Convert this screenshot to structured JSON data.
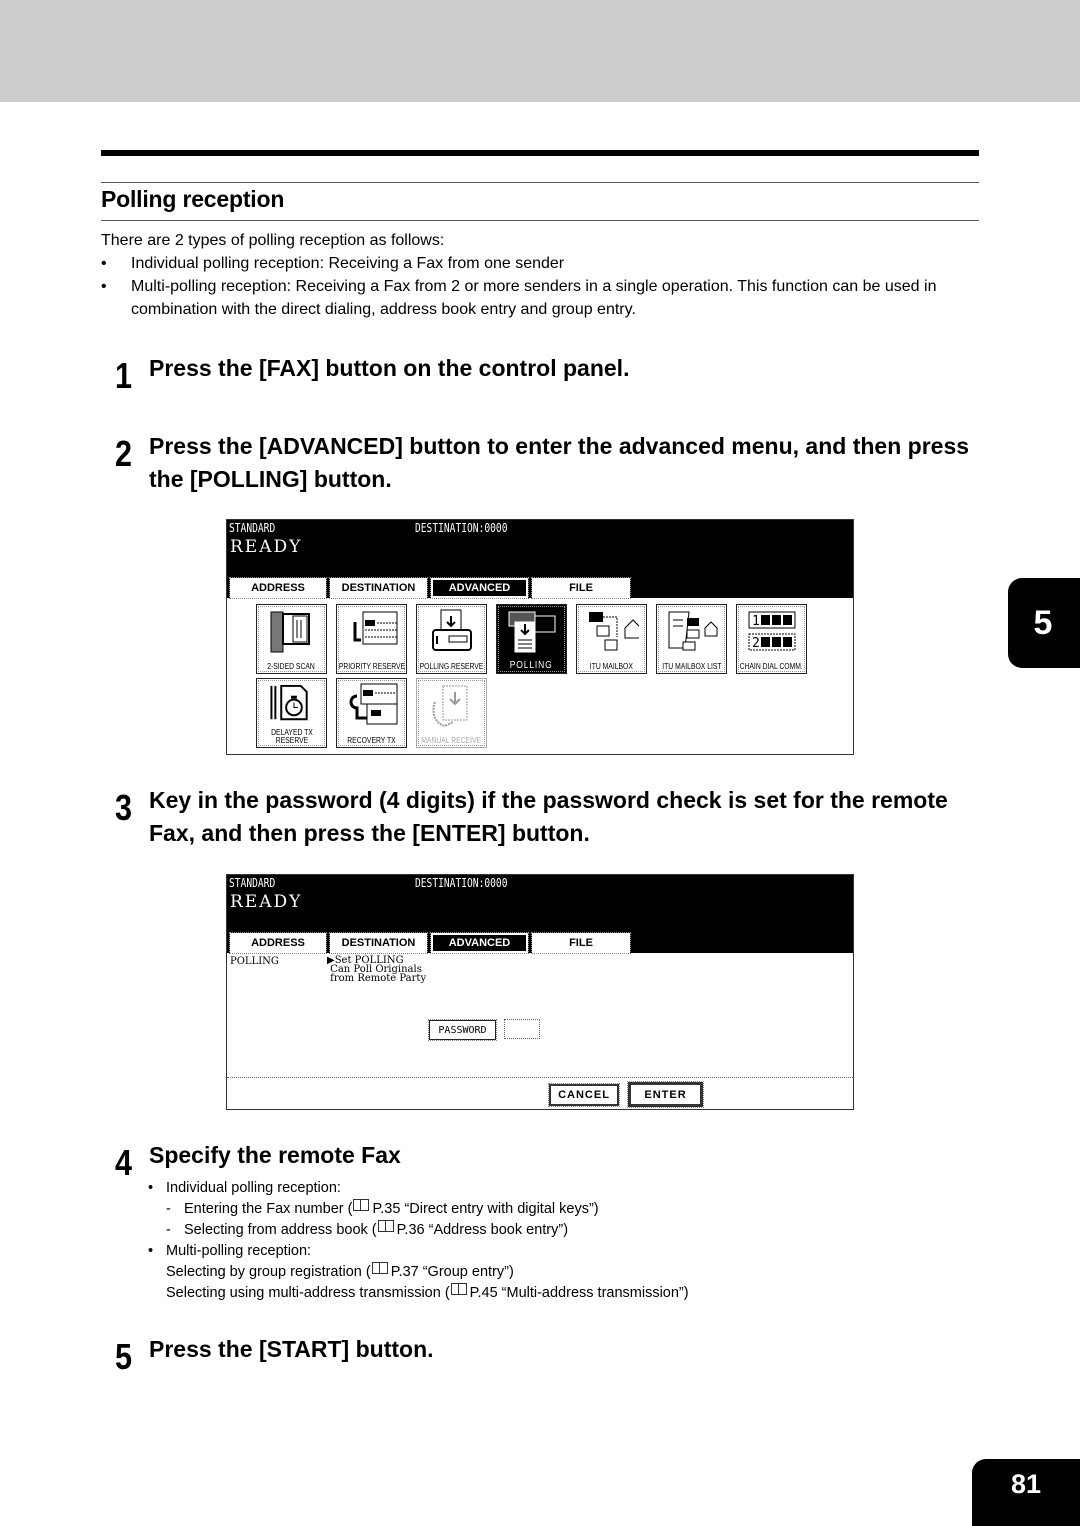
{
  "section": {
    "title": "Polling reception",
    "intro": "There are 2 types of polling reception as follows:",
    "bullets": [
      "Individual polling reception: Receiving a Fax from one sender",
      "Multi-polling reception: Receiving a Fax from 2 or more senders in a single operation. This function can be used in combination with the direct dialing, address book entry and group entry."
    ]
  },
  "steps": [
    {
      "num": "1",
      "text": "Press the [FAX] button on the control panel."
    },
    {
      "num": "2",
      "text": "Press the [ADVANCED] button to enter the advanced menu, and then press the [POLLING] button."
    },
    {
      "num": "3",
      "text": "Key in the password (4 digits) if the password check is set for the remote Fax, and then press the [ENTER] button."
    },
    {
      "num": "4",
      "text": "Specify the remote Fax"
    },
    {
      "num": "5",
      "text": "Press the [START] button."
    }
  ],
  "screen1": {
    "mode": "STANDARD",
    "destination": "DESTINATION:0000",
    "status": "READY",
    "tabs": [
      "ADDRESS",
      "DESTINATION",
      "ADVANCED",
      "FILE"
    ],
    "active_tab": "ADVANCED",
    "icons": [
      {
        "label": "2-SIDED SCAN",
        "icon": "two-sided-scan-icon"
      },
      {
        "label": "PRIORITY RESERVE",
        "icon": "priority-reserve-icon"
      },
      {
        "label": "POLLING RESERVE",
        "icon": "polling-reserve-icon"
      },
      {
        "label": "POLLING",
        "icon": "polling-icon",
        "state": "selected"
      },
      {
        "label": "ITU MAILBOX",
        "icon": "itu-mailbox-icon"
      },
      {
        "label": "ITU MAILBOX LIST",
        "icon": "itu-mailbox-list-icon"
      },
      {
        "label": "CHAIN DIAL COMM.",
        "icon": "chain-dial-icon"
      },
      {
        "label": "DELAYED TX RESERVE",
        "icon": "delayed-tx-icon"
      },
      {
        "label": "RECOVERY TX",
        "icon": "recovery-tx-icon"
      },
      {
        "label": "MANUAL RECEIVE",
        "icon": "manual-receive-icon",
        "state": "disabled"
      }
    ]
  },
  "screen2": {
    "mode": "STANDARD",
    "destination": "DESTINATION:0000",
    "status": "READY",
    "tabs": [
      "ADDRESS",
      "DESTINATION",
      "ADVANCED",
      "FILE"
    ],
    "active_tab": "ADVANCED",
    "function": "POLLING",
    "desc_lines": [
      "▶Set POLLING",
      " Can Poll Originals",
      " from Remote Party"
    ],
    "password_label": "PASSWORD",
    "password_value": "",
    "cancel_label": "CANCEL",
    "enter_label": "ENTER"
  },
  "step4": {
    "items": [
      {
        "type": "bullet",
        "text": "Individual polling reception:"
      },
      {
        "type": "dash",
        "text": "Entering the Fax number (",
        "ref": "P.35 “Direct entry with digital keys”)"
      },
      {
        "type": "dash",
        "text": "Selecting from address book (",
        "ref": "P.36 “Address book entry”)"
      },
      {
        "type": "bullet",
        "text": "Multi-polling reception:"
      },
      {
        "type": "plain",
        "text": "Selecting by group registration (",
        "ref": "P.37 “Group entry”)"
      },
      {
        "type": "plain",
        "text": "Selecting using multi-address transmission (",
        "ref": "P.45 “Multi-address transmission”)"
      }
    ]
  },
  "chapter_tab": "5",
  "page_number": "81"
}
